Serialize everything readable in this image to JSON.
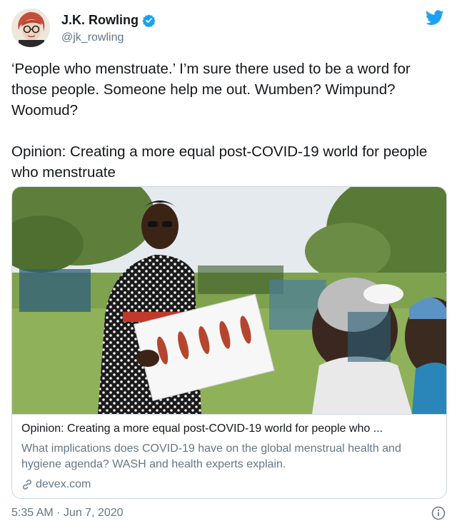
{
  "author": {
    "display_name": "J.K. Rowling",
    "handle": "@jk_rowling",
    "avatar_icon": "avatar-photo",
    "verified_icon": "verified-badge-icon"
  },
  "brand": {
    "icon": "twitter-bird-icon",
    "color": "#1da1f2"
  },
  "tweet": {
    "text": "‘People who menstruate.’ I’m sure there used to be a word for those people. Someone help me out. Wumben? Wimpund? Woomud?\n\nOpinion: Creating a more equal post-COVID-19 world for people who menstruate"
  },
  "card": {
    "title": "Opinion: Creating a more equal post-COVID-19 world for people who ...",
    "description": "What implications does COVID-19 have on the global menstrual health and hygiene agenda? WASH and health experts explain.",
    "domain": "devex.com",
    "link_icon": "link-icon"
  },
  "meta": {
    "timestamp": "5:35 AM · Jun 7, 2020",
    "info_icon": "info-icon"
  },
  "colors": {
    "text": "#14171a",
    "secondary": "#657786",
    "border": "#ccd6dd"
  }
}
